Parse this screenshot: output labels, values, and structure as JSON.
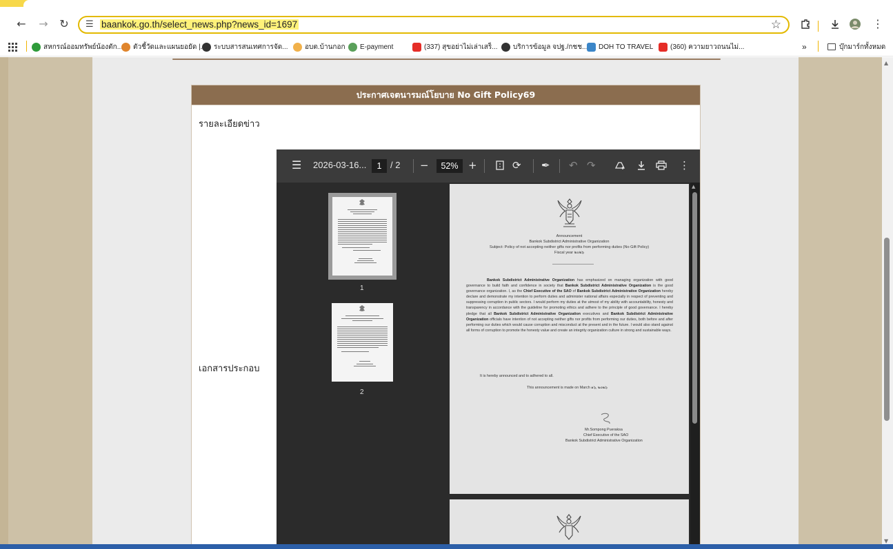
{
  "browser": {
    "url": "baankok.go.th/select_news.php?news_id=1697",
    "nav": {
      "back_icon": "back-arrow-icon",
      "forward_icon": "forward-arrow-icon",
      "reload_icon": "reload-icon"
    },
    "bookmarks": [
      {
        "label": "สหกรณ์ออมทรัพย์น้องตัก...",
        "color": "#2e9b3a"
      },
      {
        "label": "ตัวชี้วัดและแผนยอยัด |...",
        "color": "#e0852d"
      },
      {
        "label": "ระบบสารสนเทศการจัด...",
        "color": "#333333"
      },
      {
        "label": "อบต.บ้านกอก",
        "color": "#f1b14a"
      },
      {
        "label": "E-payment",
        "color": "#5aa05a"
      },
      {
        "label": "(337) สุขอย่าไม่เล่าเสร็...",
        "color": "#e52d27"
      },
      {
        "label": "บริการข้อมูล จปฐ./กชช...",
        "color": "#333333"
      },
      {
        "label": "DOH TO TRAVEL",
        "color": "#3b86c8"
      },
      {
        "label": "(360) ความยาวถนนไม่...",
        "color": "#e52d27"
      }
    ],
    "bookmarks_more": "»",
    "all_bookmarks": "บุ๊กมาร์กทั้งหมด"
  },
  "news": {
    "title": "ประกาศเจตนารมณ์โยบาย No Gift Policy69",
    "detail_label": "รายละเอียดข่าว",
    "attachment_label": "เอกสารประกอบ"
  },
  "pdf": {
    "filename": "2026-03-16...",
    "page_current": "1",
    "page_total": "/ 2",
    "zoom": "52%",
    "thumbnails": [
      {
        "number": "1"
      },
      {
        "number": "2"
      }
    ],
    "document": {
      "heading1": "Announcement",
      "heading2": "Bankok Subdistrict Administrative Organization",
      "subject": "Subject: Policy of not accepting neither gifts nor profits from performing duties (No Gift Policy)",
      "fiscal": "Fiscal year ๒๐๒๖",
      "para_part1": "Bankok Subdistrict Administrative Organization",
      "para_part2": " has emphasized on managing organization with good governance to build faith and confidence in society that ",
      "para_part3": "Bankok Subdistrict Administrative Organization",
      "para_part4": " is the good governance organization. I, as the ",
      "para_part5": "Chief Executive of the SAO",
      "para_part6": " of ",
      "para_part7": "Bankok Subdistrict Administrative Organization",
      "para_part8": " hereby declare and demonstrate my intention to perform duties and administer national affairs especially in respect of preventing and suppressing corruption in public sectors. I would perform my duties at the utmost of my ability with accountability, honesty and transparency in accordance with the guideline for promoting ethics and adhere to the principle of good governance. I hereby pledge that all ",
      "para_part9": "Bankok Subdistrict Administrative Organization",
      "para_part10": " executives and ",
      "para_part11": "Bankok Subdistrict Administrative Organization",
      "para_part12": " officials have intention of not accepting neither gifts nor profits from performing our duties, both before and after performing our duties which would cause corruption and misconduct at the present and in the future. I would also stand against all forms of corruption to promote the honesty value and create an integrity organization culture in strong and sustainable ways.",
      "announced": "It is hereby announced and to adhered to all.",
      "made_on": "This announcement is made on March  ๑๖, ๒๐๒๖",
      "signer": "Mr.Sompong Pueraksa",
      "signer_title": "Chief Executive of the SAO",
      "signer_org": "Bankok Subdistrict Administrative Organization"
    }
  }
}
